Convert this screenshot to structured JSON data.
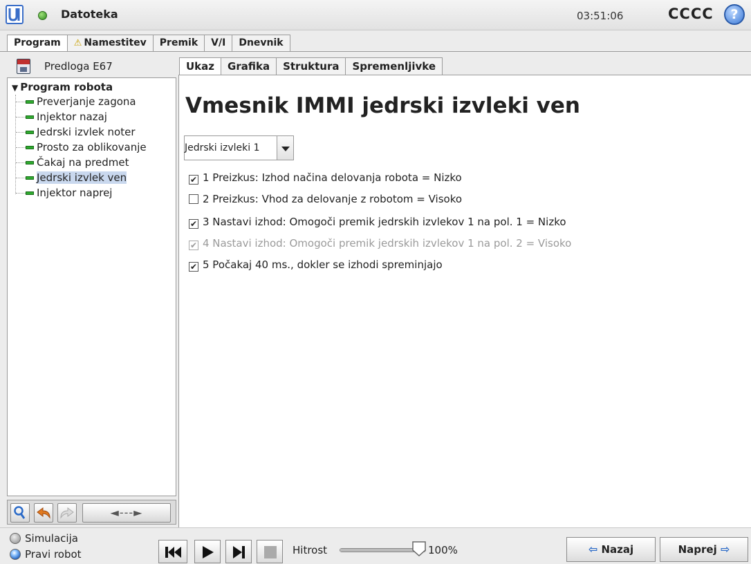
{
  "header": {
    "file_menu": "Datoteka",
    "clock": "03:51:06",
    "robot_name": "CCCC",
    "help_glyph": "?",
    "status_color": "#2e8b1e"
  },
  "main_tabs": [
    {
      "label": "Program",
      "active": true
    },
    {
      "label": "Namestitev",
      "warning": true
    },
    {
      "label": "Premik"
    },
    {
      "label": "V/I"
    },
    {
      "label": "Dnevnik"
    }
  ],
  "left_panel": {
    "program_name": "Predloga E67",
    "root_label": "Program robota",
    "items": [
      {
        "label": "Preverjanje zagona"
      },
      {
        "label": "Injektor nazaj"
      },
      {
        "label": "Jedrski izvlek noter"
      },
      {
        "label": "Prosto za oblikovanje"
      },
      {
        "label": "Čakaj na predmet"
      },
      {
        "label": "Jedrski izvlek ven",
        "selected": true
      },
      {
        "label": "Injektor naprej"
      }
    ],
    "tools": {
      "arrow_label": "◄---►"
    }
  },
  "sub_tabs": [
    {
      "label": "Ukaz",
      "active": true
    },
    {
      "label": "Grafika"
    },
    {
      "label": "Struktura"
    },
    {
      "label": "Spremenljivke"
    }
  ],
  "content": {
    "title": "Vmesnik IMMI jedrski izvleki ven",
    "dropdown_value": "Jedrski izvleki 1",
    "checks": [
      {
        "label": "1 Preizkus: Izhod načina delovanja robota = Nizko",
        "checked": true,
        "enabled": true
      },
      {
        "label": "2 Preizkus: Vhod za delovanje z robotom = Visoko",
        "checked": false,
        "enabled": true
      },
      {
        "label": "3 Nastavi izhod: Omogoči premik jedrskih izvlekov 1 na pol. 1 = Nizko",
        "checked": true,
        "enabled": true
      },
      {
        "label": "4 Nastavi izhod: Omogoči premik jedrskih izvlekov 1 na pol. 2 = Visoko",
        "checked": true,
        "enabled": false
      },
      {
        "label": "5 Počakaj 40 ms., dokler se izhodi spreminjajo",
        "checked": true,
        "enabled": true
      }
    ],
    "check_mark": "✔"
  },
  "bottom": {
    "simulation_label": "Simulacija",
    "real_robot_label": "Pravi robot",
    "real_robot_selected": true,
    "speed_label": "Hitrost",
    "speed_value": "100%",
    "speed_fraction": 1.0,
    "back_label": "Nazaj",
    "next_label": "Naprej",
    "back_arrow": "⇦",
    "next_arrow": "⇨"
  }
}
